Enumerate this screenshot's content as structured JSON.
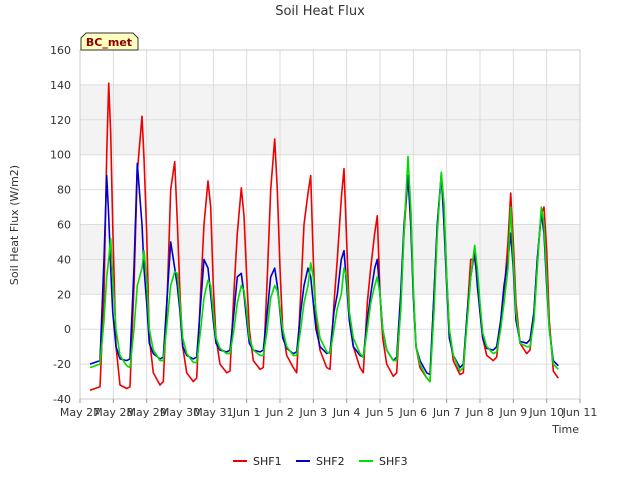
{
  "chart_data": {
    "type": "line",
    "title": "Soil Heat Flux",
    "xlabel": "Time",
    "ylabel": "Soil Heat Flux (W/m2)",
    "site_label": "BC_met",
    "xlim": [
      0,
      15
    ],
    "ylim": [
      -40,
      160
    ],
    "yticks": [
      -40,
      -20,
      0,
      20,
      40,
      60,
      80,
      100,
      120,
      140,
      160
    ],
    "xtick_labels": [
      "May 27",
      "May 28",
      "May 29",
      "May 30",
      "May 31",
      "Jun 1",
      "Jun 2",
      "Jun 3",
      "Jun 4",
      "Jun 5",
      "Jun 6",
      "Jun 7",
      "Jun 8",
      "Jun 9",
      "Jun 10",
      "Jun 11"
    ],
    "x_units": "days since May 27 00:00",
    "grid": true,
    "shaded_bands": [
      [
        20,
        60
      ],
      [
        100,
        140
      ]
    ],
    "legend_placement": "bottom-center",
    "series": [
      {
        "name": "SHF1",
        "color": "#ee0000",
        "x": [
          0.3,
          0.6,
          0.72,
          0.8,
          0.86,
          0.92,
          0.98,
          1.08,
          1.2,
          1.4,
          1.5,
          1.62,
          1.72,
          1.86,
          1.92,
          2.0,
          2.08,
          2.2,
          2.4,
          2.5,
          2.62,
          2.72,
          2.84,
          2.92,
          3.0,
          3.08,
          3.2,
          3.4,
          3.5,
          3.62,
          3.72,
          3.84,
          3.92,
          4.0,
          4.08,
          4.2,
          4.4,
          4.5,
          4.62,
          4.72,
          4.84,
          4.92,
          5.0,
          5.08,
          5.2,
          5.4,
          5.5,
          5.62,
          5.72,
          5.84,
          5.92,
          6.0,
          6.08,
          6.2,
          6.4,
          6.5,
          6.62,
          6.72,
          6.84,
          6.92,
          7.0,
          7.08,
          7.2,
          7.4,
          7.5,
          7.62,
          7.72,
          7.84,
          7.92,
          8.0,
          8.08,
          8.2,
          8.4,
          8.5,
          8.62,
          8.72,
          8.84,
          8.92,
          9.0,
          9.08,
          9.2,
          9.4,
          9.5,
          9.62,
          9.72,
          9.84,
          9.92,
          10.0,
          10.08,
          10.2,
          10.4,
          10.5,
          10.62,
          10.72,
          10.84,
          10.92,
          11.0,
          11.08,
          11.2,
          11.4,
          11.5,
          11.62,
          11.72,
          11.84,
          11.92,
          12.0,
          12.08,
          12.2,
          12.4,
          12.5,
          12.62,
          12.72,
          12.84,
          12.92,
          13.0,
          13.08,
          13.2,
          13.4,
          13.5,
          13.62,
          13.72,
          13.84,
          13.92,
          14.0,
          14.08,
          14.2,
          14.35
        ],
        "y": [
          -35,
          -33,
          20,
          100,
          141,
          112,
          60,
          -10,
          -32,
          -34,
          -33,
          25,
          90,
          122,
          98,
          55,
          -5,
          -25,
          -32,
          -30,
          20,
          80,
          96,
          62,
          20,
          -10,
          -25,
          -30,
          -28,
          22,
          60,
          85,
          70,
          25,
          -5,
          -20,
          -25,
          -24,
          22,
          55,
          81,
          65,
          30,
          0,
          -18,
          -23,
          -22,
          30,
          80,
          109,
          80,
          35,
          0,
          -15,
          -22,
          -25,
          20,
          60,
          78,
          88,
          40,
          5,
          -12,
          -22,
          -23,
          15,
          40,
          75,
          92,
          50,
          10,
          -10,
          -22,
          -25,
          15,
          35,
          55,
          65,
          20,
          -5,
          -20,
          -27,
          -25,
          15,
          55,
          88,
          70,
          20,
          -10,
          -22,
          -28,
          -30,
          20,
          60,
          88,
          70,
          30,
          0,
          -18,
          -26,
          -25,
          10,
          40,
          40,
          30,
          10,
          -5,
          -15,
          -18,
          -16,
          5,
          20,
          50,
          78,
          50,
          15,
          -8,
          -14,
          -12,
          10,
          40,
          66,
          70,
          45,
          5,
          -24,
          -28
        ]
      },
      {
        "name": "SHF2",
        "color": "#0000cc",
        "x": [
          0.3,
          0.6,
          0.72,
          0.8,
          0.86,
          0.92,
          0.98,
          1.08,
          1.2,
          1.4,
          1.5,
          1.62,
          1.72,
          1.86,
          1.92,
          2.0,
          2.08,
          2.2,
          2.4,
          2.5,
          2.62,
          2.72,
          2.84,
          2.92,
          3.0,
          3.08,
          3.2,
          3.4,
          3.5,
          3.62,
          3.72,
          3.84,
          3.92,
          4.0,
          4.08,
          4.2,
          4.4,
          4.5,
          4.62,
          4.72,
          4.84,
          4.92,
          5.0,
          5.08,
          5.2,
          5.4,
          5.5,
          5.62,
          5.72,
          5.84,
          5.92,
          6.0,
          6.08,
          6.2,
          6.4,
          6.5,
          6.62,
          6.72,
          6.84,
          6.92,
          7.0,
          7.08,
          7.2,
          7.4,
          7.5,
          7.62,
          7.72,
          7.84,
          7.92,
          8.0,
          8.08,
          8.2,
          8.4,
          8.5,
          8.62,
          8.72,
          8.84,
          8.92,
          9.0,
          9.08,
          9.2,
          9.4,
          9.5,
          9.62,
          9.72,
          9.84,
          9.92,
          10.0,
          10.08,
          10.2,
          10.4,
          10.5,
          10.62,
          10.72,
          10.84,
          10.92,
          11.0,
          11.08,
          11.2,
          11.4,
          11.5,
          11.62,
          11.72,
          11.84,
          11.92,
          12.0,
          12.08,
          12.2,
          12.4,
          12.5,
          12.62,
          12.72,
          12.84,
          12.92,
          13.0,
          13.08,
          13.2,
          13.4,
          13.5,
          13.62,
          13.72,
          13.84,
          13.92,
          14.0,
          14.08,
          14.2,
          14.35
        ],
        "y": [
          -20,
          -18,
          40,
          88,
          65,
          35,
          10,
          -10,
          -17,
          -18,
          -17,
          35,
          95,
          60,
          35,
          15,
          -8,
          -14,
          -17,
          -16,
          20,
          50,
          35,
          25,
          10,
          -10,
          -15,
          -17,
          -16,
          15,
          40,
          35,
          20,
          5,
          -8,
          -12,
          -13,
          -12,
          10,
          30,
          32,
          20,
          5,
          -8,
          -12,
          -13,
          -12,
          10,
          30,
          35,
          25,
          10,
          -5,
          -11,
          -14,
          -13,
          10,
          25,
          35,
          30,
          15,
          0,
          -10,
          -14,
          -13,
          10,
          20,
          40,
          45,
          25,
          5,
          -10,
          -15,
          -16,
          5,
          20,
          35,
          40,
          20,
          0,
          -12,
          -18,
          -16,
          20,
          60,
          88,
          60,
          20,
          -10,
          -18,
          -25,
          -26,
          20,
          60,
          89,
          60,
          25,
          -5,
          -15,
          -22,
          -20,
          10,
          30,
          45,
          25,
          10,
          -5,
          -11,
          -12,
          -10,
          5,
          25,
          40,
          55,
          35,
          5,
          -7,
          -8,
          -6,
          10,
          40,
          67,
          55,
          25,
          0,
          -18,
          -21
        ]
      },
      {
        "name": "SHF3",
        "color": "#00dd00",
        "x": [
          0.3,
          0.6,
          0.72,
          0.8,
          0.86,
          0.92,
          0.98,
          1.08,
          1.2,
          1.4,
          1.5,
          1.62,
          1.72,
          1.86,
          1.92,
          2.0,
          2.08,
          2.2,
          2.4,
          2.5,
          2.62,
          2.72,
          2.84,
          2.92,
          3.0,
          3.08,
          3.2,
          3.4,
          3.5,
          3.62,
          3.72,
          3.84,
          3.92,
          4.0,
          4.08,
          4.2,
          4.4,
          4.5,
          4.62,
          4.72,
          4.84,
          4.92,
          5.0,
          5.08,
          5.2,
          5.4,
          5.5,
          5.62,
          5.72,
          5.84,
          5.92,
          6.0,
          6.08,
          6.2,
          6.4,
          6.5,
          6.62,
          6.72,
          6.84,
          6.92,
          7.0,
          7.08,
          7.2,
          7.4,
          7.5,
          7.62,
          7.72,
          7.84,
          7.92,
          8.0,
          8.08,
          8.2,
          8.4,
          8.5,
          8.62,
          8.72,
          8.84,
          8.92,
          9.0,
          9.08,
          9.2,
          9.4,
          9.5,
          9.62,
          9.72,
          9.84,
          9.92,
          10.0,
          10.08,
          10.2,
          10.4,
          10.5,
          10.62,
          10.72,
          10.84,
          10.92,
          11.0,
          11.08,
          11.2,
          11.4,
          11.5,
          11.62,
          11.72,
          11.84,
          11.92,
          12.0,
          12.08,
          12.2,
          12.4,
          12.5,
          12.62,
          12.72,
          12.84,
          12.92,
          13.0,
          13.08,
          13.2,
          13.4,
          13.5,
          13.62,
          13.72,
          13.84,
          13.92,
          14.0,
          14.08,
          14.2,
          14.35
        ],
        "y": [
          -22,
          -20,
          5,
          30,
          40,
          52,
          30,
          0,
          -15,
          -21,
          -22,
          0,
          25,
          35,
          45,
          28,
          0,
          -12,
          -18,
          -18,
          5,
          25,
          33,
          32,
          15,
          -5,
          -14,
          -19,
          -19,
          0,
          18,
          28,
          25,
          10,
          -5,
          -11,
          -14,
          -14,
          0,
          15,
          25,
          22,
          10,
          -5,
          -12,
          -15,
          -15,
          0,
          18,
          25,
          22,
          12,
          0,
          -10,
          -15,
          -15,
          0,
          15,
          25,
          38,
          30,
          10,
          -5,
          -13,
          -14,
          0,
          12,
          20,
          35,
          30,
          10,
          -5,
          -14,
          -16,
          0,
          15,
          25,
          30,
          20,
          0,
          -12,
          -18,
          -18,
          10,
          55,
          99,
          70,
          25,
          -10,
          -20,
          -28,
          -30,
          10,
          55,
          90,
          72,
          30,
          0,
          -15,
          -24,
          -22,
          5,
          30,
          48,
          35,
          15,
          -2,
          -10,
          -14,
          -13,
          0,
          15,
          35,
          70,
          40,
          10,
          -8,
          -10,
          -10,
          5,
          35,
          70,
          60,
          30,
          0,
          -20,
          -23
        ]
      }
    ]
  }
}
